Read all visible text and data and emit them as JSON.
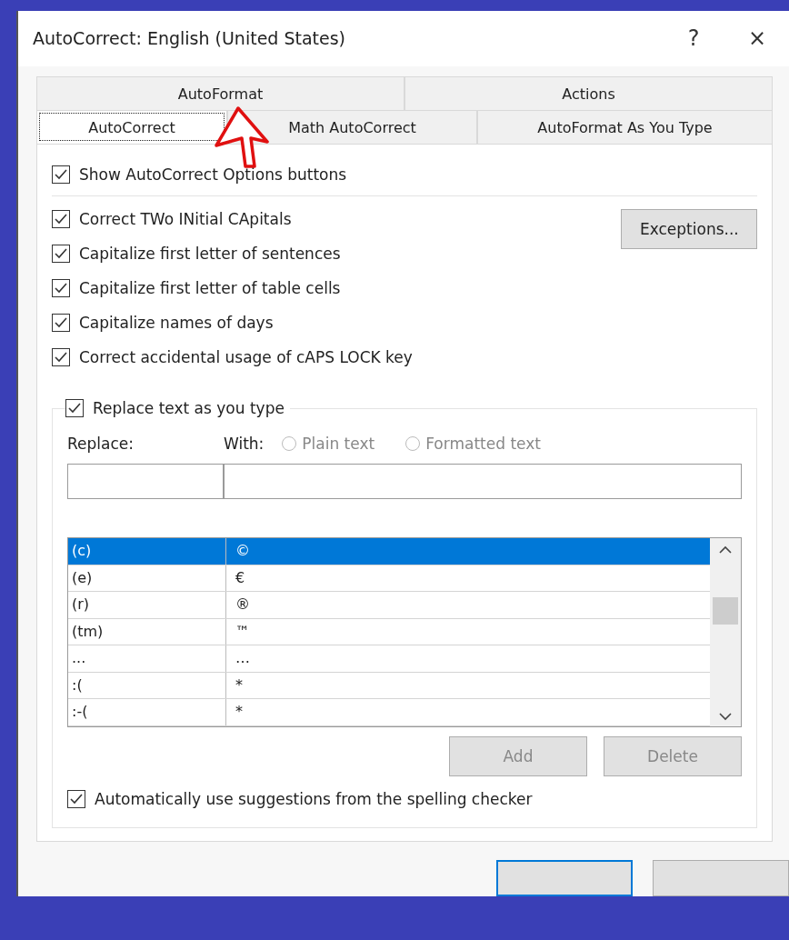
{
  "window": {
    "title": "AutoCorrect: English (United States)",
    "help": "?",
    "close": "×"
  },
  "tab_rows": [
    [
      {
        "label": "AutoFormat",
        "selected": false
      },
      {
        "label": "Actions",
        "selected": false
      }
    ],
    [
      {
        "label": "AutoCorrect",
        "selected": true
      },
      {
        "label": "Math AutoCorrect",
        "selected": false
      },
      {
        "label": "AutoFormat As You Type",
        "selected": false
      }
    ]
  ],
  "show_options": {
    "label": "Show AutoCorrect Options buttons",
    "checked": true
  },
  "options": [
    {
      "label": "Correct TWo INitial CApitals",
      "checked": true
    },
    {
      "label": "Capitalize first letter of sentences",
      "checked": true
    },
    {
      "label": "Capitalize first letter of table cells",
      "checked": true
    },
    {
      "label": "Capitalize names of days",
      "checked": true
    },
    {
      "label": "Correct accidental usage of cAPS LOCK key",
      "checked": true
    }
  ],
  "exceptions_button": "Exceptions...",
  "replace_group": {
    "label": "Replace text as you type",
    "checked": true,
    "replace_label": "Replace:",
    "with_label": "With:",
    "format_options": [
      {
        "label": "Plain text",
        "selected": false,
        "disabled": true
      },
      {
        "label": "Formatted text",
        "selected": false,
        "disabled": true
      }
    ]
  },
  "table": {
    "rows": [
      {
        "replace": "(c)",
        "with": "©",
        "selected": true
      },
      {
        "replace": "(e)",
        "with": "€",
        "selected": false
      },
      {
        "replace": "(r)",
        "with": "®",
        "selected": false
      },
      {
        "replace": "(tm)",
        "with": "™",
        "selected": false
      },
      {
        "replace": "...",
        "with": "…",
        "selected": false
      },
      {
        "replace": ":(",
        "with": "*",
        "selected": false
      },
      {
        "replace": ":-(",
        "with": "*",
        "selected": false
      }
    ]
  },
  "buttons": [
    {
      "label": "Add",
      "disabled": true
    },
    {
      "label": "Delete",
      "disabled": true
    }
  ],
  "spelling": {
    "label": "Automatically use suggestions from the spelling checker",
    "checked": true
  },
  "dialog_buttons": [
    {
      "kind": "default"
    },
    {
      "kind": "normal"
    }
  ]
}
